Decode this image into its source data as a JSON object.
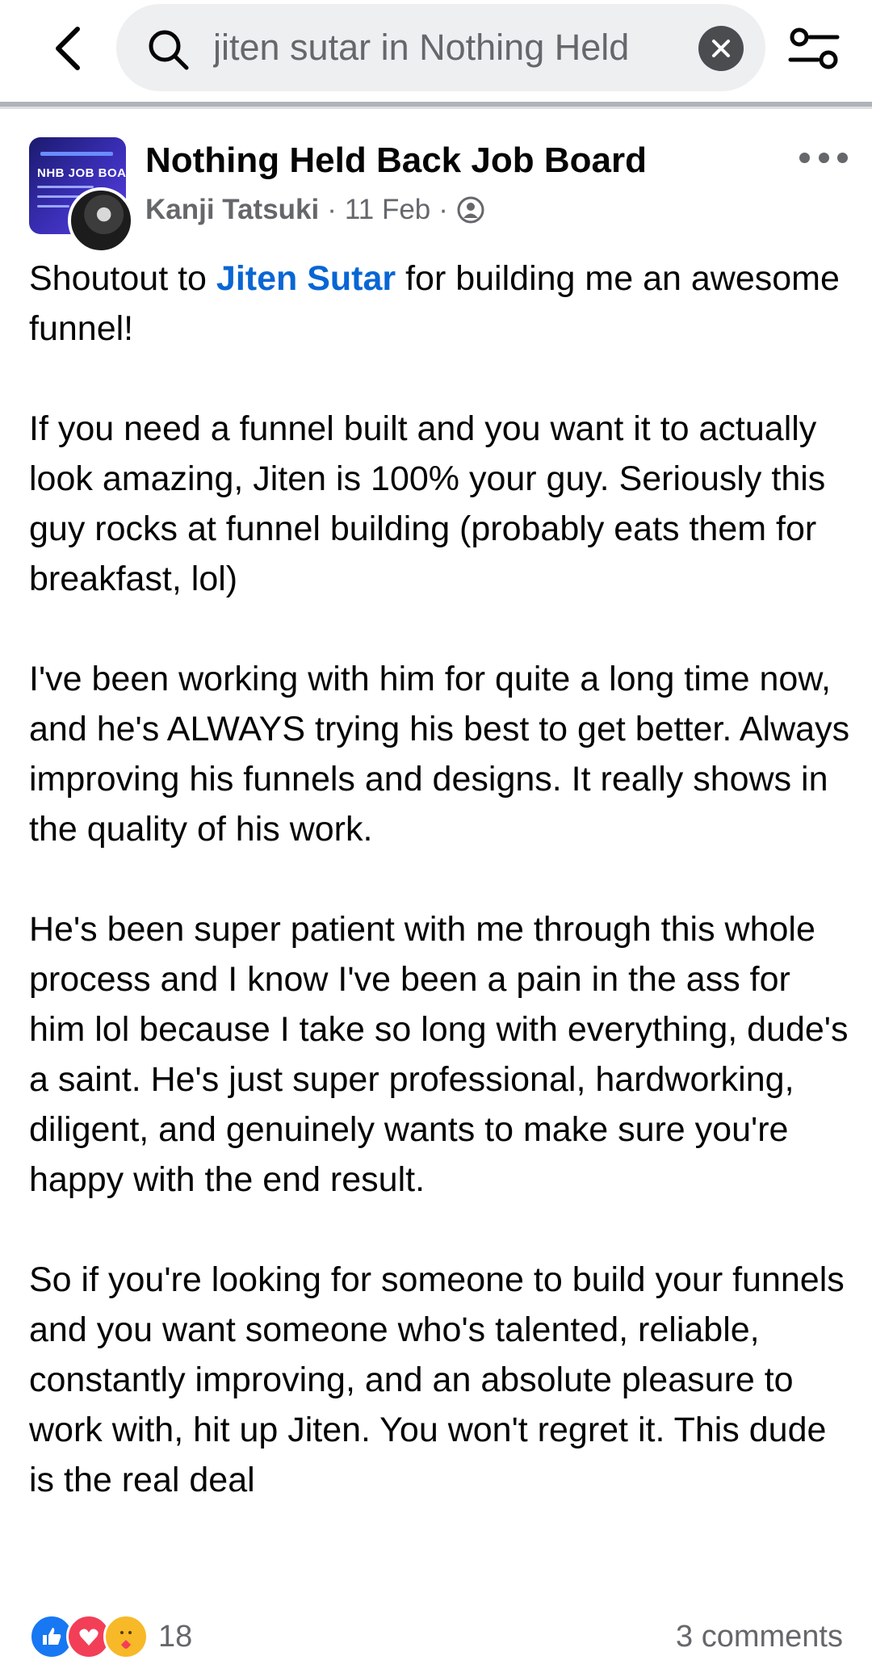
{
  "search": {
    "query": "jiten sutar in Nothing Held"
  },
  "post": {
    "group_name": "Nothing Held Back Job Board",
    "group_avatar_text": "NHB JOB BOARD",
    "author": "Kanji Tatsuki",
    "separator": "·",
    "date": "11 Feb",
    "paragraph1": {
      "before": "Shoutout to ",
      "mention": "Jiten Sutar",
      "after": " for building me an awesome funnel!"
    },
    "paragraph2": "If you need a funnel built and you want it to actually look amazing, Jiten is 100% your guy. Seriously this guy rocks at funnel building (probably eats them for breakfast, lol)",
    "paragraph3": "I've been working with him for quite a long time now, and he's ALWAYS trying his best to get better. Always improving his funnels and designs. It really shows in the quality of his work.",
    "paragraph4": "He's been super patient with me through this whole process and I know I've been a pain in the ass for him lol because I take so long with everything, dude's a saint. He's just super professional, hardworking, diligent, and genuinely wants to make sure you're happy with the end result.",
    "paragraph5": "So if you're looking for someone to build your funnels and you want someone who's talented, reliable, constantly improving, and an absolute pleasure to work with, hit up Jiten. You won't regret it. This dude is the real deal",
    "reaction_count": "18",
    "comments": "3 comments"
  },
  "icons": {
    "back": "chevron-left-icon",
    "search": "search-icon",
    "clear": "close-icon",
    "filter": "filter-sliders-icon",
    "more": "more-horizontal-icon",
    "privacy": "group-members-icon",
    "reactions": [
      "like-reaction-icon",
      "love-reaction-icon",
      "care-reaction-icon"
    ]
  },
  "colors": {
    "mention": "#0866d4",
    "like": "#1877f2",
    "love": "#f33e58",
    "care": "#f7b928",
    "meta_text": "#65676b"
  }
}
